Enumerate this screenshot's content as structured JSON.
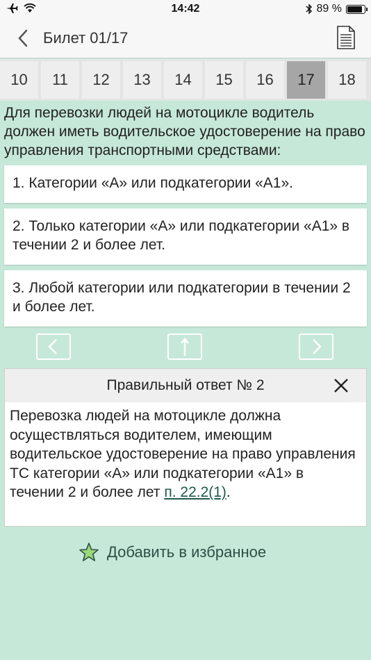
{
  "status": {
    "time": "14:42",
    "battery_percent": "89 %",
    "battery_level": 0.89
  },
  "nav": {
    "title": "Билет 01/17"
  },
  "tabs": [
    {
      "label": "10",
      "active": false
    },
    {
      "label": "11",
      "active": false
    },
    {
      "label": "12",
      "active": false
    },
    {
      "label": "13",
      "active": false
    },
    {
      "label": "14",
      "active": false
    },
    {
      "label": "15",
      "active": false
    },
    {
      "label": "16",
      "active": false
    },
    {
      "label": "17",
      "active": true
    },
    {
      "label": "18",
      "active": false
    }
  ],
  "question": {
    "text": "Для перевозки людей на мотоцикле водитель должен иметь водительское удостоверение на право управления транспортными средствами:"
  },
  "answers": [
    {
      "text": "1. Категории «А» или подкатегории «А1»."
    },
    {
      "text": "2. Только категории «А» или подкатегории «А1» в течении 2 и более лет."
    },
    {
      "text": "3. Любой категории или подкатегории в течении 2 и более лет."
    }
  ],
  "result": {
    "title": "Правильный ответ № 2",
    "explanation": "Перевозка людей на мотоцикле должна осуществляться водителем, имеющим водительское удостоверение на право управления ТС категории «А» или подкатегории «А1» в течении 2 и более лет ",
    "link_text": "п. 22.2(1)",
    "trailing": "."
  },
  "favorite": {
    "label": "Добавить в избранное"
  },
  "colors": {
    "background": "#c6e8d8",
    "active_tab": "#a6a6a6",
    "link": "#1e5a4c"
  },
  "icons": [
    "airplane-icon",
    "wifi-icon",
    "bluetooth-icon",
    "battery-icon",
    "back-chevron-icon",
    "document-icon",
    "prev-arrow-icon",
    "up-arrow-icon",
    "next-arrow-icon",
    "close-icon",
    "star-icon"
  ]
}
